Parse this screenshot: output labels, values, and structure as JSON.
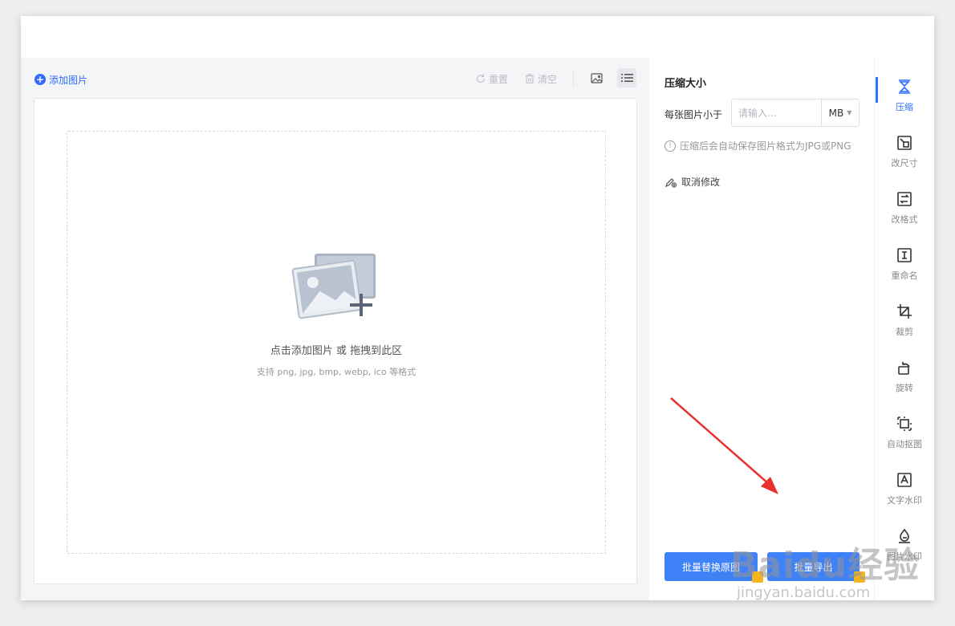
{
  "toolbar": {
    "add_image": "添加图片",
    "reset": "重置",
    "clear": "清空"
  },
  "dropzone": {
    "title": "点击添加图片 或 拖拽到此区",
    "subtitle": "支持 png, jpg, bmp, webp, ico 等格式"
  },
  "settings": {
    "section_title": "压缩大小",
    "size_label": "每张图片小于",
    "size_value": "",
    "size_placeholder": "请输入...",
    "unit": "MB",
    "hint": "压缩后会自动保存图片格式为JPG或PNG",
    "cancel_edit": "取消修改",
    "replace_button": "批量替换原图",
    "export_button": "批量导出"
  },
  "sidebar": {
    "items": [
      {
        "label": "压缩",
        "icon": "compress-icon",
        "active": true
      },
      {
        "label": "改尺寸",
        "icon": "resize-icon"
      },
      {
        "label": "改格式",
        "icon": "format-icon"
      },
      {
        "label": "重命名",
        "icon": "rename-icon"
      },
      {
        "label": "裁剪",
        "icon": "crop-icon"
      },
      {
        "label": "旋转",
        "icon": "rotate-icon"
      },
      {
        "label": "自动抠图",
        "icon": "cutout-icon"
      },
      {
        "label": "文字水印",
        "icon": "text-watermark-icon"
      },
      {
        "label": "图片水印",
        "icon": "image-watermark-icon"
      }
    ]
  },
  "watermark": {
    "logo": "Baidu经验",
    "url": "jingyan.baidu.com"
  },
  "colors": {
    "accent": "#2f6bff",
    "button": "#3f82f7",
    "annotation_arrow": "#e8312f",
    "vip_badge": "#f5b51e"
  }
}
